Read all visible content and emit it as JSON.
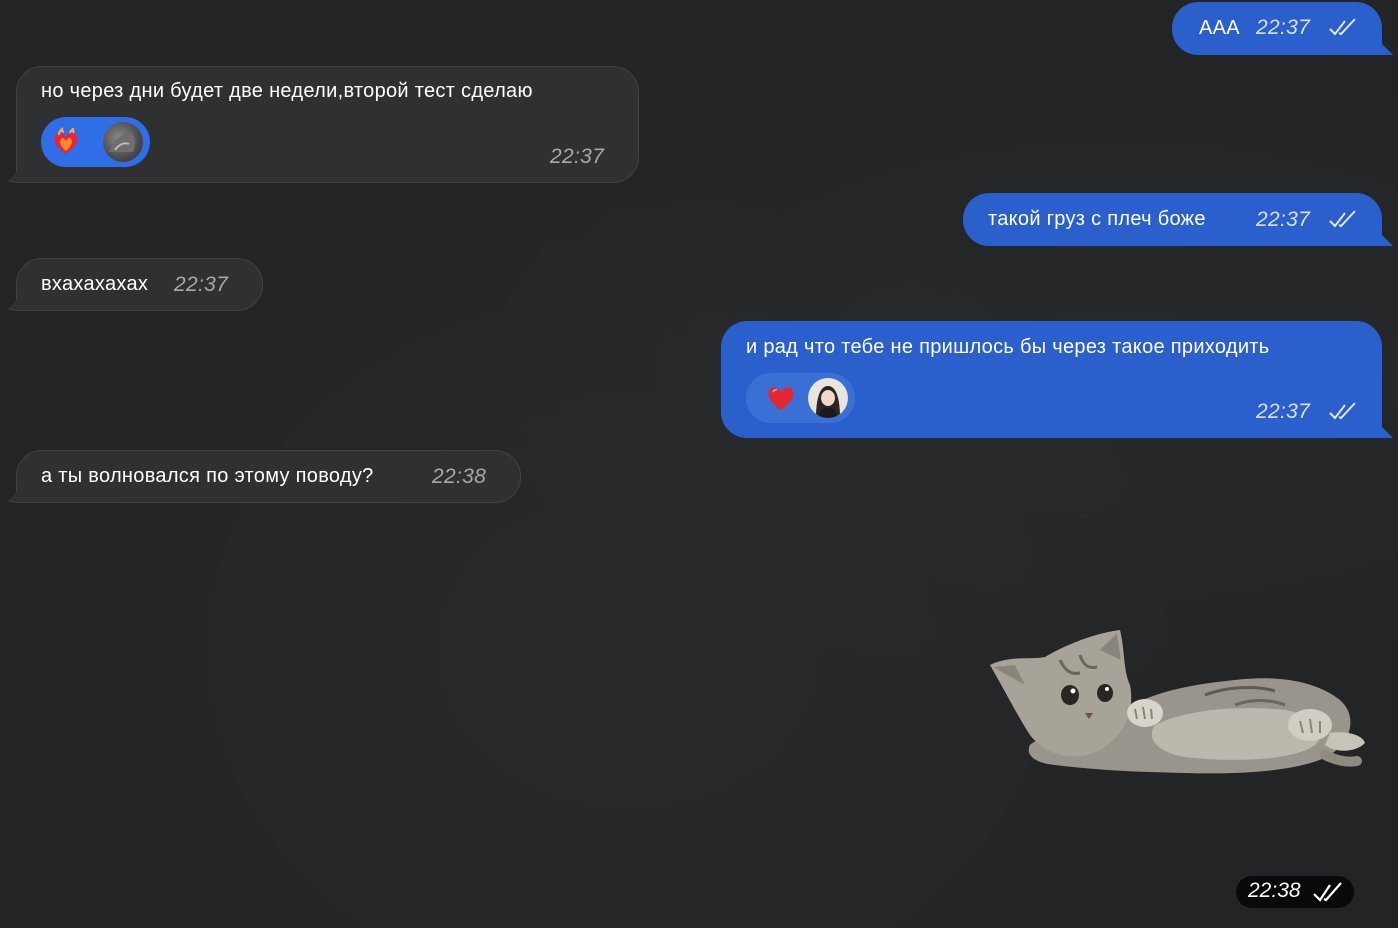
{
  "messages": [
    {
      "text": "AAA",
      "time": "22:37",
      "direction": "out",
      "status": "read"
    },
    {
      "text": "но через дни будет две недели,второй тест сделаю",
      "time": "22:37",
      "direction": "in",
      "reaction": {
        "emoji": "heart-on-fire"
      }
    },
    {
      "text": "такой груз с плеч боже",
      "time": "22:37",
      "direction": "out",
      "status": "read"
    },
    {
      "text": "вхахахахах",
      "time": "22:37",
      "direction": "in"
    },
    {
      "text": "и рад что тебе не пришлось бы через такое приходить",
      "time": "22:37",
      "direction": "out",
      "status": "read",
      "reaction": {
        "emoji": "red-heart"
      }
    },
    {
      "text": "а ты волновался по этому поводу?",
      "time": "22:38",
      "direction": "in"
    },
    {
      "type": "sticker",
      "sticker": "kitten-lying",
      "time": "22:38",
      "direction": "out",
      "status": "read"
    }
  ],
  "colors": {
    "background": "#222426",
    "incoming_bubble": "#2e3032",
    "outgoing_bubble": "#2a5fcc",
    "reaction_pill_incoming": "#2f6ee6",
    "reaction_pill_outgoing": "#3a70d6"
  }
}
